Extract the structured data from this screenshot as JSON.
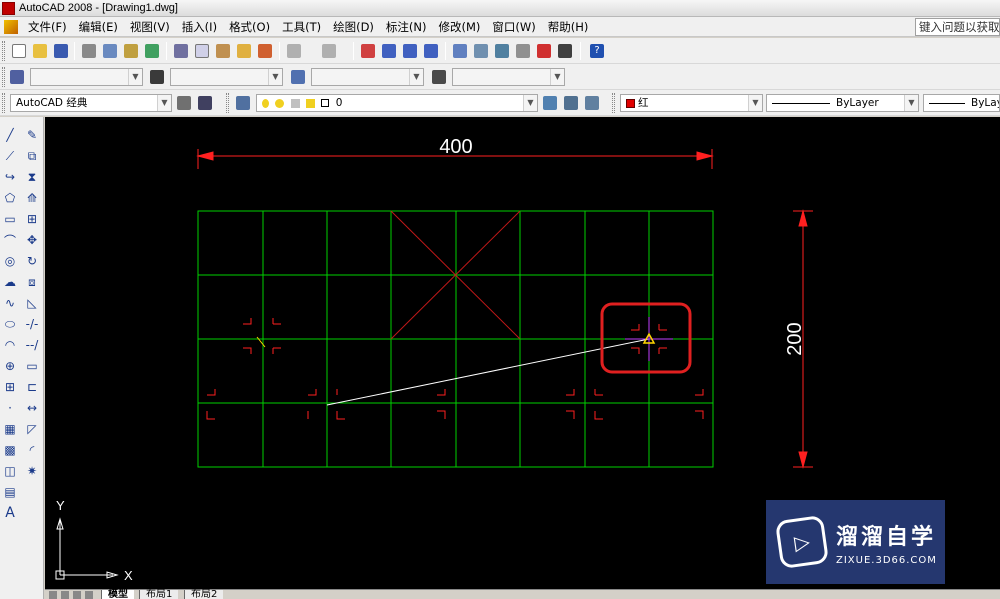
{
  "window": {
    "title": "AutoCAD 2008 - [Drawing1.dwg]"
  },
  "menu": {
    "items": [
      "文件(F)",
      "编辑(E)",
      "视图(V)",
      "插入(I)",
      "格式(O)",
      "工具(T)",
      "绘图(D)",
      "标注(N)",
      "修改(M)",
      "窗口(W)",
      "帮助(H)"
    ],
    "help_placeholder": "键入问题以获取帮"
  },
  "toolbars": {
    "workspace": "AutoCAD 经典",
    "layer_current": "0",
    "color": "红",
    "linetype": "ByLayer",
    "lineweight": "ByLayer"
  },
  "drawing": {
    "dimension_horizontal": "400",
    "dimension_vertical": "200",
    "ucs_x_label": "X",
    "ucs_y_label": "Y"
  },
  "colors": {
    "canvas": "#000000",
    "grid_lines": "#00d000",
    "dimension": "#ff2020",
    "highlight_box": "#e02020",
    "guide_line": "#ffffff"
  },
  "tabs": [
    "模型",
    "布局1",
    "布局2"
  ],
  "watermark": {
    "name": "溜溜自学",
    "site": "ZIXUE.3D66.COM"
  }
}
